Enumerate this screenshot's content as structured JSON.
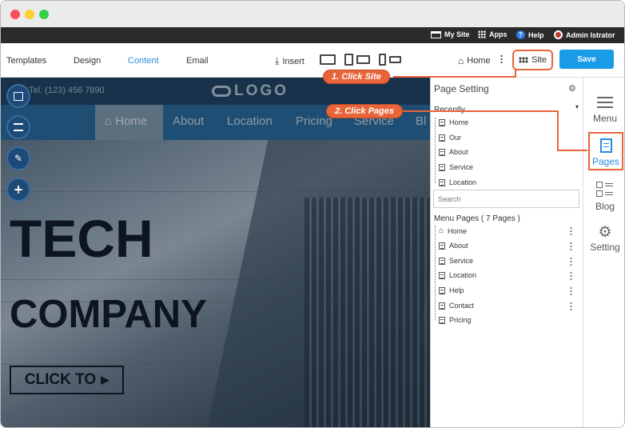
{
  "topbar": {
    "my_site": "My Site",
    "apps": "Apps",
    "help": "Help",
    "user": "Admin Istrator"
  },
  "toolbar": {
    "tabs": [
      "Templates",
      "Design",
      "Content",
      "Email"
    ],
    "insert": "Insert",
    "home": "Home",
    "site": "Site",
    "save": "Save"
  },
  "site": {
    "phone": "Tel. (123) 456 7890",
    "logo": "LOGO",
    "nav": [
      "Home",
      "About",
      "Location",
      "Pricing",
      "Service",
      "Bl"
    ],
    "hero_line1": "TECH",
    "hero_line2": "COMPANY",
    "cta": "CLICK TO"
  },
  "panel": {
    "title": "Page Setting",
    "recently_label": "Recently",
    "recent": [
      "Home",
      "Our",
      "About",
      "Service",
      "Location"
    ],
    "search_placeholder": "Search",
    "menu_label": "Menu Pages ( 7 Pages )",
    "menu_pages": [
      "Home",
      "About",
      "Service",
      "Location",
      "Help",
      "Contact",
      "Pricing"
    ]
  },
  "rail": {
    "items": [
      "Menu",
      "Pages",
      "Blog",
      "Setting"
    ]
  },
  "callouts": {
    "step1": "1. Click Site",
    "step2": "2. Click Pages"
  },
  "colors": {
    "accent": "#e8653a",
    "save": "#1a9be8",
    "nav": "#2b6ea2",
    "topbar": "#2b2b2b"
  }
}
